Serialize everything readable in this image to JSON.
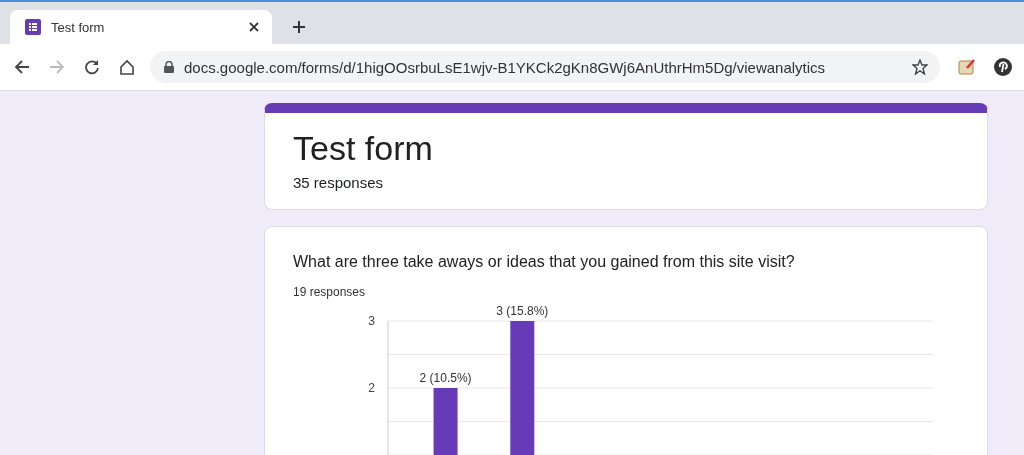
{
  "browser": {
    "tab": {
      "title": "Test form",
      "selected": true
    },
    "address": "docs.google.com/forms/d/1higOOsrbuLsE1wjv-B1YKCk2gKn8GWj6AnUthrHm5Dg/viewanalytics"
  },
  "form": {
    "title": "Test form",
    "responses": "35 responses"
  },
  "question": {
    "text": "What are three take aways or ideas that you gained from this site visit?",
    "responses": "19 responses",
    "chart_data": {
      "type": "bar",
      "values": [
        null,
        2,
        null,
        3,
        null,
        null,
        null,
        null,
        null,
        null,
        null,
        null,
        null,
        null,
        null,
        null
      ],
      "ylim": [
        0,
        3
      ],
      "yticks": [
        2,
        3
      ],
      "data_labels": true,
      "value_labels": [
        null,
        "2 (10.5%)",
        null,
        "3 (15.8%)",
        null,
        null,
        null,
        null,
        null,
        null,
        null,
        null,
        null,
        null,
        null,
        null
      ]
    }
  }
}
